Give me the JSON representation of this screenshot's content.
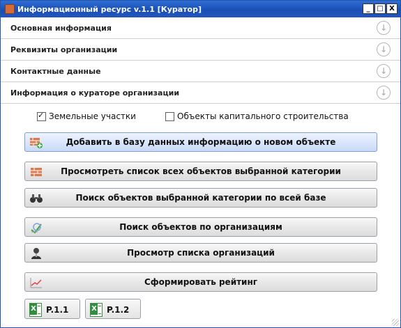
{
  "window": {
    "title": "Информационный ресурс v.1.1 [Куратор]",
    "controls": {
      "minimize": "_",
      "maximize": "□",
      "close": "X"
    }
  },
  "sections": [
    {
      "label": "Основная информация"
    },
    {
      "label": "Реквизиты организации"
    },
    {
      "label": "Контактные данные"
    },
    {
      "label": "Информация о кураторе организации"
    }
  ],
  "checkboxes": {
    "land": {
      "label": "Земельные участки",
      "checked": true
    },
    "capital": {
      "label": "Объекты капитального строительства",
      "checked": false
    }
  },
  "buttons": [
    {
      "label": "Добавить в базу данных информацию о новом объекте",
      "icon": "add-bricks-icon"
    },
    {
      "label": "Просмотреть список всех объектов выбранной категории",
      "icon": "bricks-icon"
    },
    {
      "label": "Поиск объектов выбранной категории по всей базе",
      "icon": "binoculars-icon"
    },
    {
      "label": "Поиск объектов по организациям",
      "icon": "search-org-icon"
    },
    {
      "label": "Просмотр списка организаций",
      "icon": "user-icon"
    },
    {
      "label": "Сформировать рейтинг",
      "icon": "chart-icon"
    }
  ],
  "reports": [
    {
      "label": "P.1.1",
      "icon": "excel-icon"
    },
    {
      "label": "P.1.2",
      "icon": "excel-icon"
    }
  ]
}
